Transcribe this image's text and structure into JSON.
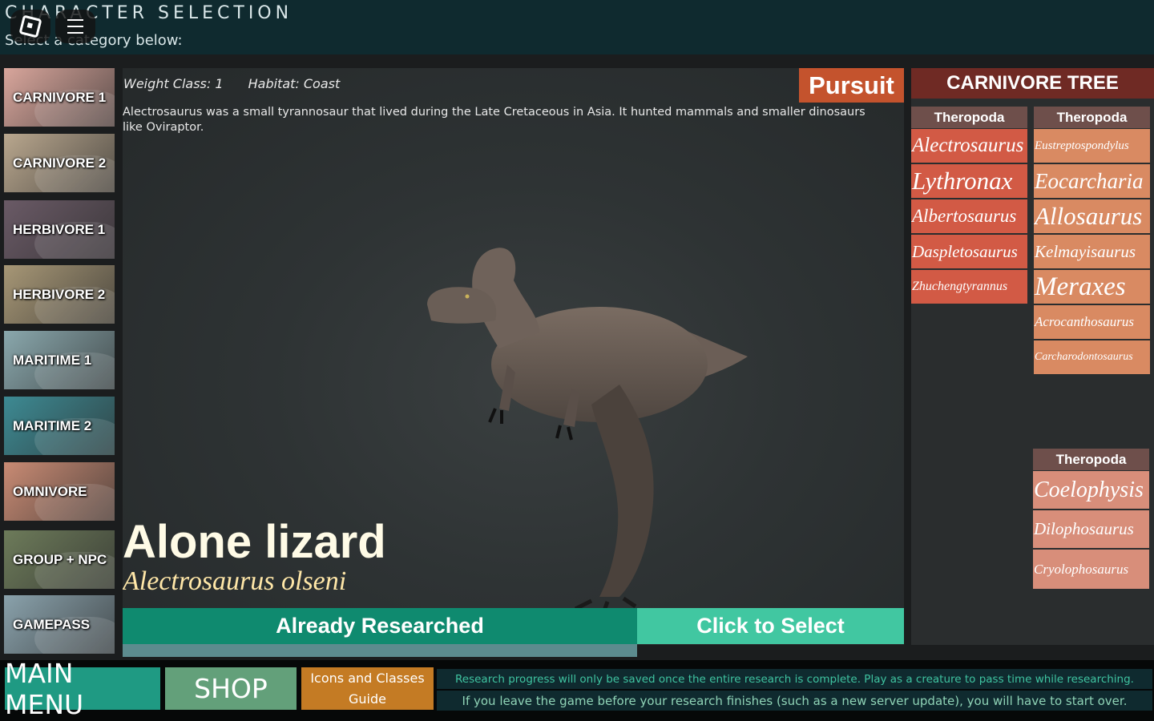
{
  "header": {
    "title": "CHARACTER SELECTION",
    "subtitle": "Select a category below:"
  },
  "categories": [
    {
      "label": "CARNIVORE 1",
      "color": "#d9a69c"
    },
    {
      "label": "CARNIVORE 2",
      "color": "#b9a78e"
    },
    {
      "label": "HERBIVORE 1",
      "color": "#6a5a66"
    },
    {
      "label": "HERBIVORE 2",
      "color": "#a79776"
    },
    {
      "label": "MARITIME 1",
      "color": "#8aa8ad"
    },
    {
      "label": "MARITIME 2",
      "color": "#3d8a93"
    },
    {
      "label": "OMNIVORE",
      "color": "#c98b74"
    },
    {
      "label": "GROUP + NPC",
      "color": "#6d7b5a"
    },
    {
      "label": "GAMEPASS",
      "color": "#8aa2ac"
    }
  ],
  "creature": {
    "weight_class": "Weight Class: 1",
    "habitat": "Habitat: Coast",
    "description": "Alectrosaurus was a small tyrannosaur that lived during the Late Cretaceous in Asia. It hunted mammals and smaller dinosaurs like Oviraptor.",
    "playstyle": "Pursuit",
    "common_name": "Alone lizard",
    "scientific_name": "Alectrosaurus olseni"
  },
  "actions": {
    "researched": "Already Researched",
    "select": "Click to Select",
    "research_progress": 1.0
  },
  "tree": {
    "title": "CARNIVORE TREE",
    "col1_head": "Theropoda",
    "col1": [
      "Alectrosaurus",
      "Lythronax",
      "Albertosaurus",
      "Daspletosaurus",
      "Zhuchengtyrannus"
    ],
    "col2_head": "Theropoda",
    "col2": [
      "Eustreptospondylus",
      "Eocarcharia",
      "Allosaurus",
      "Kelmayisaurus",
      "Meraxes",
      "Acrocanthosaurus",
      "Carcharodontosaurus"
    ],
    "col3_head": "Theropoda",
    "col3": [
      "Coelophysis",
      "Dilophosaurus",
      "Cryolophosaurus"
    ]
  },
  "footer": {
    "main_menu": "MAIN MENU",
    "shop": "SHOP",
    "guide_line1": "Icons and Classes",
    "guide_line2": "Guide",
    "note1": "Research progress will only be saved once the entire research is complete. Play as a creature to pass time while researching.",
    "note2": "If you leave the game before your research finishes (such as a new server update), you will have to start over."
  }
}
